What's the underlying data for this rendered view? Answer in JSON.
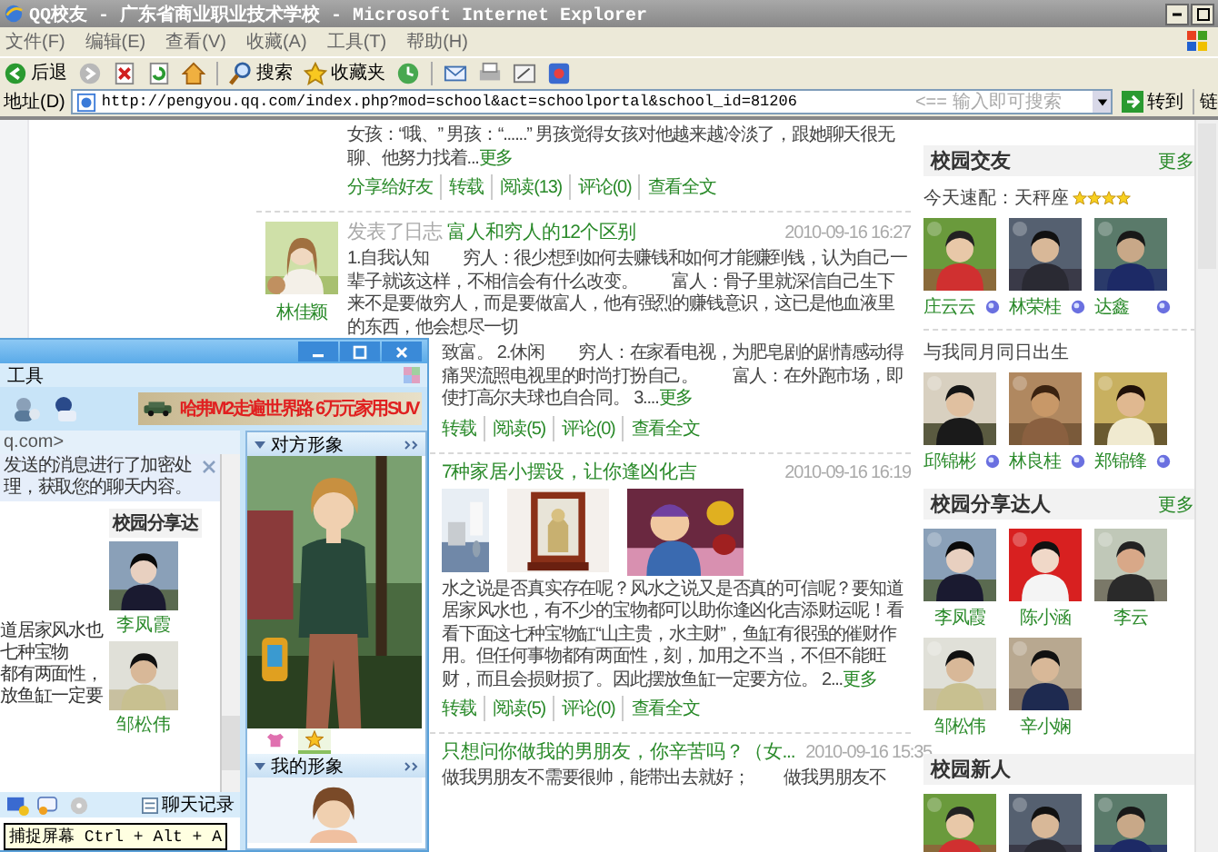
{
  "window": {
    "title": "QQ校友 - 广东省商业职业技术学校 - Microsoft Internet Explorer"
  },
  "menu": [
    "文件(F)",
    "编辑(E)",
    "查看(V)",
    "收藏(A)",
    "工具(T)",
    "帮助(H)"
  ],
  "toolbar": [
    {
      "kind": "back",
      "label": "后退"
    },
    {
      "kind": "forward"
    },
    {
      "kind": "stop"
    },
    {
      "kind": "refresh"
    },
    {
      "kind": "home"
    },
    {
      "kind": "search",
      "label": "搜索"
    },
    {
      "kind": "favorites",
      "label": "收藏夹"
    },
    {
      "kind": "history"
    },
    {
      "kind": "mail"
    },
    {
      "kind": "print"
    },
    {
      "kind": "edit"
    },
    {
      "kind": "messenger"
    }
  ],
  "address_bar": {
    "label": "地址(D)",
    "url": "http://pengyou.qq.com/index.php?mod=school&act=schoolportal&school_id=81206",
    "search_arrow": "<==",
    "search_placeholder": "输入即可搜索",
    "go": "转到",
    "links": "链"
  },
  "posts": [
    {
      "body": [
        {
          "text": "女孩：“哦、” 男孩：“......” 男孩觉得女孩对他越来越冷淡了，跟她聊天很无聊、他努力找着...",
          "cut": false
        }
      ],
      "more": "更多",
      "actions": [
        "分享给好友",
        "转载",
        "阅读(13)",
        "评论(0)",
        "查看全文"
      ]
    },
    {
      "author": "林佳颖",
      "verb": "发表了日志",
      "title": "富人和穷人的12个区别",
      "date": "2010-09-16 16:27",
      "body": [
        {
          "text": "1.自我认知　　穷人：很少想到如何去赚钱和如何才能赚到钱，认为自己一辈子就该这样，不相信会有什么改变。　　富人：骨子里就深信自己生下来不是要做穷人，而是要做富人，他有强烈的赚钱意识，这已是他血液里的东西，他会想尽一切",
          "cut": false
        },
        {
          "text": "致富。 2.休闲　　穷人：在家看电视，为肥皂剧的剧情感动得痛哭流照电视里的时尚打扮自己。　　富人：在外跑市场，即使打高尔夫球也自合同。 3....",
          "cut": true
        }
      ],
      "more": "更多",
      "actions": [
        "转载",
        "阅读(5)",
        "评论(0)",
        "查看全文"
      ]
    },
    {
      "title": "7种家居小摆设，让你逢凶化吉",
      "date": "2010-09-16 16:19",
      "images": [
        {
          "kind": "picture"
        },
        {
          "kind": "picture"
        },
        {
          "kind": "picture"
        }
      ],
      "body": [
        {
          "text": "水之说是否真实存在呢？风水之说又是否真的可信呢？要知道居家风水也，有不少的宝物都可以助你逢凶化吉添财运呢！看看下面这七种宝物缸“山主贵，水主财”，鱼缸有很强的催财作用。但任何事物都有两面性，刻，加用之不当，不但不能旺财，而且会损财损了。因此摆放鱼缸一定要方位。 2...",
          "cut": true
        }
      ],
      "more": "更多",
      "actions": [
        "转载",
        "阅读(5)",
        "评论(0)",
        "查看全文"
      ]
    },
    {
      "title": "只想问你做我的男朋友，你辛苦吗？（女...",
      "date": "2010-09-16 15:35",
      "body": [
        {
          "text": "做我男朋友不需要很帅，能带出去就好；　　做我男朋友不",
          "cut": true
        }
      ]
    }
  ],
  "sidebar": [
    {
      "kind": "friends",
      "title": "校园交友",
      "more": "更多",
      "groups": [
        {
          "caption": "今天速配：天秤座",
          "stars": 4,
          "people": [
            {
              "name": "庄云云"
            },
            {
              "name": "林荣桂"
            },
            {
              "name": "达鑫"
            }
          ]
        },
        {
          "caption": "与我同月同日出生",
          "people": [
            {
              "name": "邱锦彬"
            },
            {
              "name": "林良桂"
            },
            {
              "name": "郑锦锋"
            }
          ]
        }
      ]
    },
    {
      "kind": "sharers",
      "title": "校园分享达人",
      "more": "更多",
      "groups": [
        {
          "people": [
            {
              "name": "李凤霞"
            },
            {
              "name": "陈小涵"
            },
            {
              "name": "李云"
            },
            {
              "name": "邹松伟"
            },
            {
              "name": "辛小娴"
            }
          ]
        }
      ]
    },
    {
      "kind": "newcomers",
      "title": "校园新人",
      "groups": [
        {
          "people": [
            {
              "kind": "picture"
            },
            {
              "kind": "picture"
            },
            {
              "kind": "picture"
            }
          ]
        }
      ]
    }
  ],
  "chat_window": {
    "menu": "工具",
    "ad": "哈弗M2走遍世界路  6万元家用SUV",
    "address_fragment": "q.com>",
    "notice": "发送的消息进行了加密处理，获取您的聊天内容。",
    "shared_title": "校园分享达",
    "shared_people": [
      "李凤霞",
      "邹松伟"
    ],
    "shared_lines": [
      "道居家风水也",
      "七种宝物",
      "都有两面性，",
      "放鱼缸一定要"
    ],
    "partner_panel": "对方形象",
    "my_panel": "我的形象",
    "history": "聊天记录",
    "tooltip": "捕捉屏幕 Ctrl + Alt + A",
    "avatar_tabs": [
      {
        "selected": false
      },
      {
        "selected": true
      }
    ]
  }
}
